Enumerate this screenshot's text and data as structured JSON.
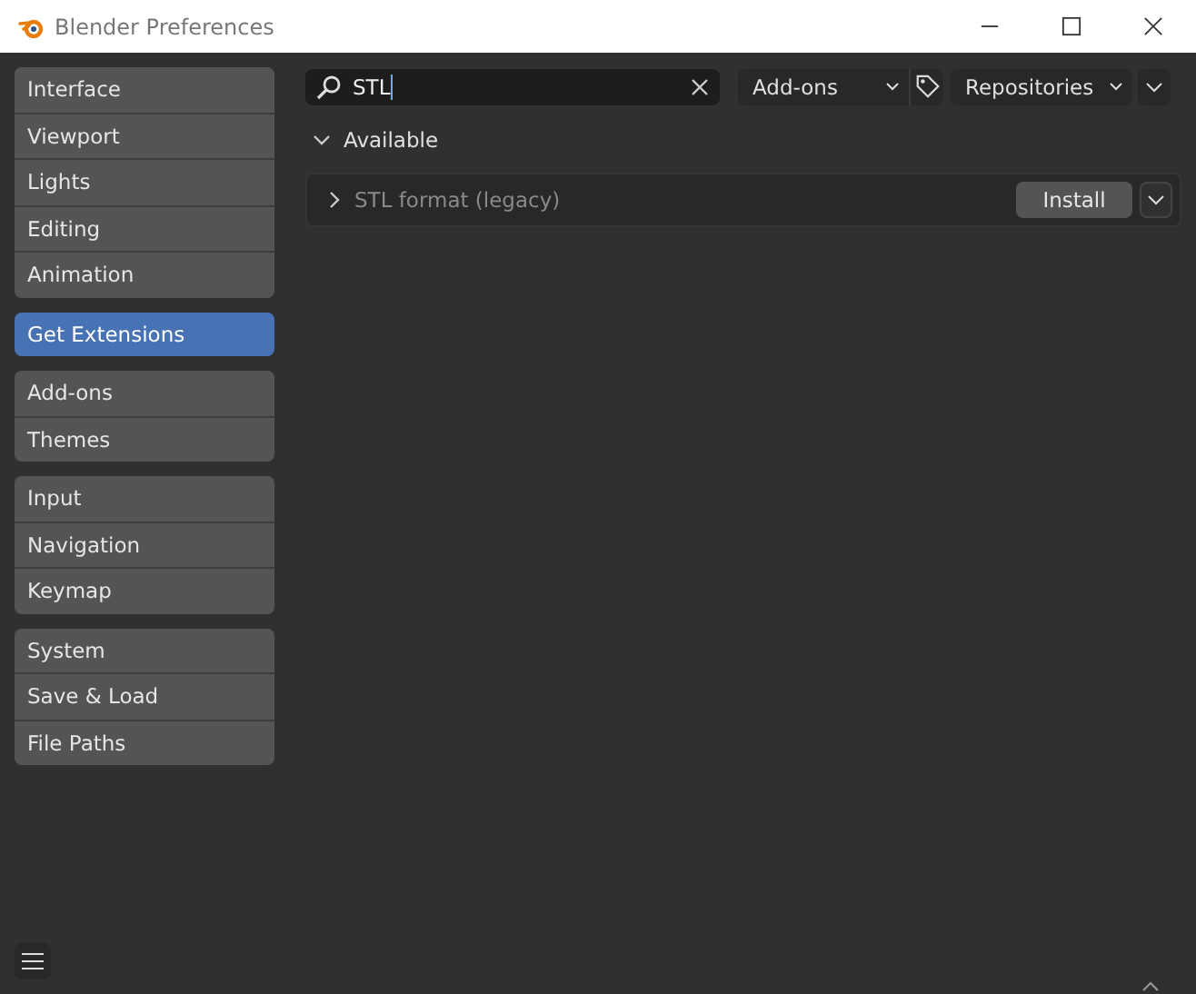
{
  "window": {
    "title": "Blender Preferences"
  },
  "sidebar": {
    "groups": [
      [
        {
          "label": "Interface",
          "selected": false
        },
        {
          "label": "Viewport",
          "selected": false
        },
        {
          "label": "Lights",
          "selected": false
        },
        {
          "label": "Editing",
          "selected": false
        },
        {
          "label": "Animation",
          "selected": false
        }
      ],
      [
        {
          "label": "Get Extensions",
          "selected": true
        }
      ],
      [
        {
          "label": "Add-ons",
          "selected": false
        },
        {
          "label": "Themes",
          "selected": false
        }
      ],
      [
        {
          "label": "Input",
          "selected": false
        },
        {
          "label": "Navigation",
          "selected": false
        },
        {
          "label": "Keymap",
          "selected": false
        }
      ],
      [
        {
          "label": "System",
          "selected": false
        },
        {
          "label": "Save & Load",
          "selected": false
        },
        {
          "label": "File Paths",
          "selected": false
        }
      ]
    ]
  },
  "search": {
    "value": "STL"
  },
  "filter": {
    "value": "Add-ons"
  },
  "repositories": {
    "value": "Repositories"
  },
  "section": {
    "title": "Available",
    "expanded": true,
    "items": [
      {
        "name": "STL format (legacy)",
        "expanded": false,
        "action": "Install"
      }
    ]
  }
}
